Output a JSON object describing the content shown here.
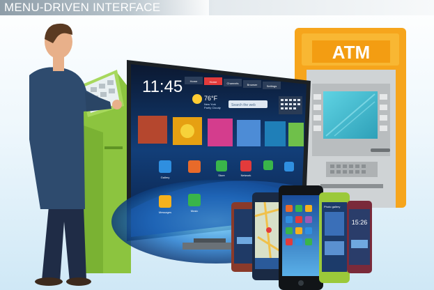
{
  "title": "MENU-DRIVEN INTERFACE",
  "tv": {
    "clock": "11:45",
    "weather_temp": "76°F",
    "weather_place": "New York",
    "weather_cond": "Partly Cloudy",
    "search_placeholder": "Search the web",
    "tabs": [
      "Home",
      "Home",
      "Channels",
      "Browser",
      "Settings"
    ],
    "app_labels": [
      "Gallery",
      "",
      "Store",
      "Network",
      "",
      "",
      "Messages",
      "Music",
      "",
      ""
    ]
  },
  "atm": {
    "label": "ATM"
  },
  "phones": {
    "left_clock": "",
    "right_clock": "15:26",
    "gallery_label": "Photo gallery"
  },
  "colors": {
    "atm_orange": "#f6a51c",
    "atm_gray": "#cfd3d5",
    "kiosk_green": "#8cc43f",
    "tv_bezel": "#1c2125",
    "shirt_blue": "#2e4b6e",
    "pants_navy": "#1f2c46"
  }
}
